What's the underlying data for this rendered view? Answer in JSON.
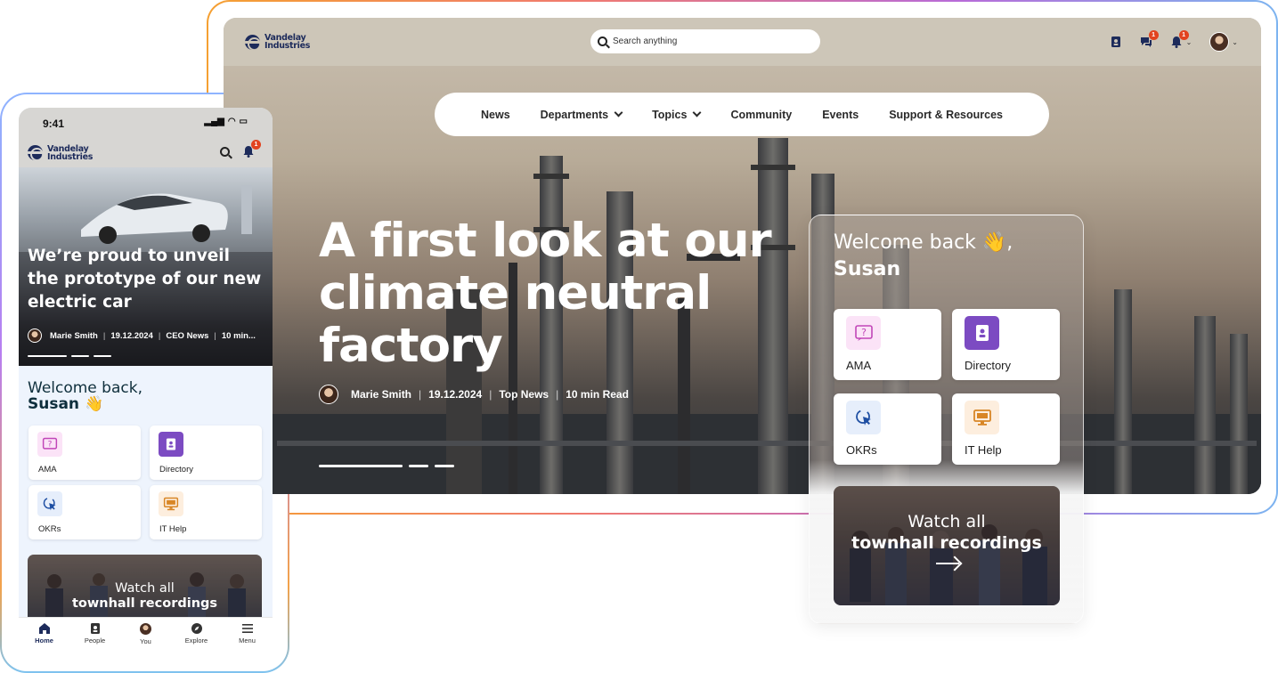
{
  "desktop": {
    "brand": {
      "line1": "Vandelay",
      "line2": "Industries"
    },
    "search": {
      "placeholder": "Search anything"
    },
    "badges": {
      "chat": "1",
      "notifications": "1"
    },
    "nav": [
      {
        "label": "News"
      },
      {
        "label": "Departments"
      },
      {
        "label": "Topics"
      },
      {
        "label": "Community"
      },
      {
        "label": "Events"
      },
      {
        "label": "Support & Resources"
      }
    ],
    "hero": {
      "title": "A first look at our climate neutral factory",
      "author": "Marie Smith",
      "date": "19.12.2024",
      "category": "Top News",
      "read_time": "10 min Read"
    },
    "welcome": {
      "greeting": "Welcome back 👋,",
      "name": "Susan"
    },
    "tiles": [
      {
        "label": "AMA",
        "icon": "question-icon",
        "bg": "#fbe3f7",
        "color": "#c146b8"
      },
      {
        "label": "Directory",
        "icon": "contact-book-icon",
        "bg": "#7c4bc2",
        "color": "#ffffff"
      },
      {
        "label": "OKRs",
        "icon": "cursor-click-icon",
        "bg": "#e6eefb",
        "color": "#1f4fa3"
      },
      {
        "label": "IT Help",
        "icon": "monitor-icon",
        "bg": "#fdeede",
        "color": "#d88626"
      }
    ],
    "townhall": {
      "line1": "Watch all",
      "line2": "townhall recordings"
    }
  },
  "mobile": {
    "status_time": "9:41",
    "brand": {
      "line1": "Vandelay",
      "line2": "Industries"
    },
    "notif_badge": "1",
    "hero": {
      "title": "We’re proud to unveil the prototype of our new electric car",
      "author": "Marie Smith",
      "date": "19.12.2024",
      "category": "CEO News",
      "read_time": "10 min..."
    },
    "welcome": {
      "greeting": "Welcome back,",
      "name": "Susan 👋"
    },
    "tiles": [
      {
        "label": "AMA"
      },
      {
        "label": "Directory"
      },
      {
        "label": "OKRs"
      },
      {
        "label": "IT Help"
      }
    ],
    "townhall": {
      "line1": "Watch all",
      "line2": "townhall recordings"
    },
    "tabs": [
      {
        "label": "Home"
      },
      {
        "label": "People"
      },
      {
        "label": "You"
      },
      {
        "label": "Explore"
      },
      {
        "label": "Menu"
      }
    ]
  }
}
